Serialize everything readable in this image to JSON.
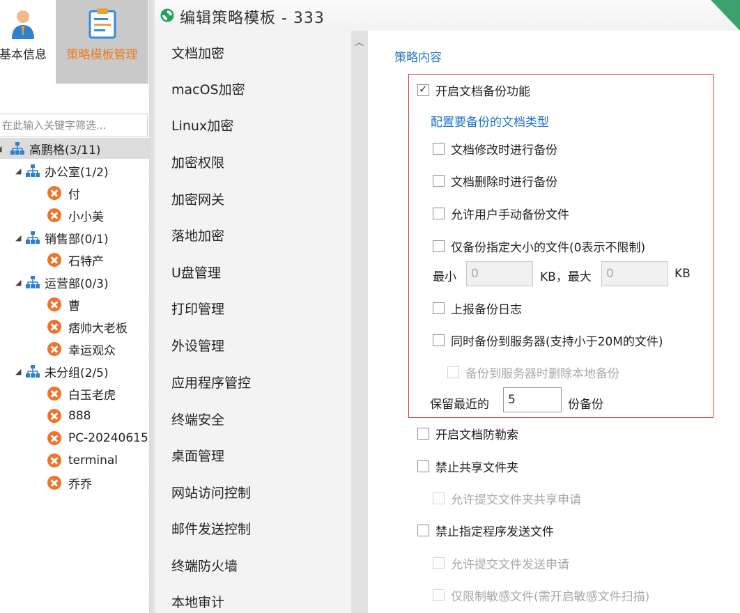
{
  "toolbar": {
    "basic_info_label": "基本信息",
    "policy_template_label": "策略模板管理"
  },
  "tree": {
    "filter_placeholder": "在此输入关键字筛选...",
    "root": "高鹏格(3/11)",
    "groups": [
      {
        "label": "办公室(1/2)",
        "members": [
          "付",
          "小小美"
        ]
      },
      {
        "label": "销售部(0/1)",
        "members": [
          "石特产"
        ]
      },
      {
        "label": "运营部(0/3)",
        "members": [
          "曹",
          "痞帅大老板",
          "幸运观众"
        ]
      },
      {
        "label": "未分组(2/5)",
        "members": [
          "白玉老虎",
          "888",
          "PC-20240615",
          "terminal",
          "乔乔"
        ]
      }
    ]
  },
  "dialog": {
    "title": "编辑策略模板 - 333"
  },
  "menu": {
    "items": [
      "文档加密",
      "macOS加密",
      "Linux加密",
      "加密权限",
      "加密网关",
      "落地加密",
      "U盘管理",
      "打印管理",
      "外设管理",
      "应用程序管控",
      "终端安全",
      "桌面管理",
      "网站访问控制",
      "邮件发送控制",
      "终端防火墙",
      "本地审计"
    ]
  },
  "content": {
    "section_title": "策略内容",
    "enable_backup": "开启文档备份功能",
    "config_types_link": "配置要备份的文档类型",
    "backup_on_modify": "文档修改时进行备份",
    "backup_on_delete": "文档删除时进行备份",
    "allow_manual_backup": "允许用户手动备份文件",
    "size_limit_only": "仅备份指定大小的文件(0表示不限制)",
    "min_label": "最小",
    "min_value": "0",
    "kb_max_label": "KB，最大",
    "max_value": "0",
    "kb_label": "KB",
    "report_backup_log": "上报备份日志",
    "backup_to_server": "同时备份到服务器(支持小于20M的文件)",
    "delete_local_after_server": "备份到服务器时删除本地备份",
    "keep_recent_label": "保留最近的",
    "keep_recent_value": "5",
    "backup_count_suffix": "份备份",
    "enable_anti_ransom": "开启文档防勒索",
    "forbid_shared_folder": "禁止共享文件夹",
    "allow_share_request": "允许提交文件夹共享申请",
    "forbid_program_send": "禁止指定程序发送文件",
    "allow_send_request": "允许提交文件发送申请",
    "sensitive_only": "仅限制敏感文件(需开启敏感文件扫描)"
  },
  "colors": {
    "accent_orange": "#f07a1a",
    "link_blue": "#1a73c9",
    "highlight_border": "#e0343a",
    "error_icon": "#f0732a"
  }
}
